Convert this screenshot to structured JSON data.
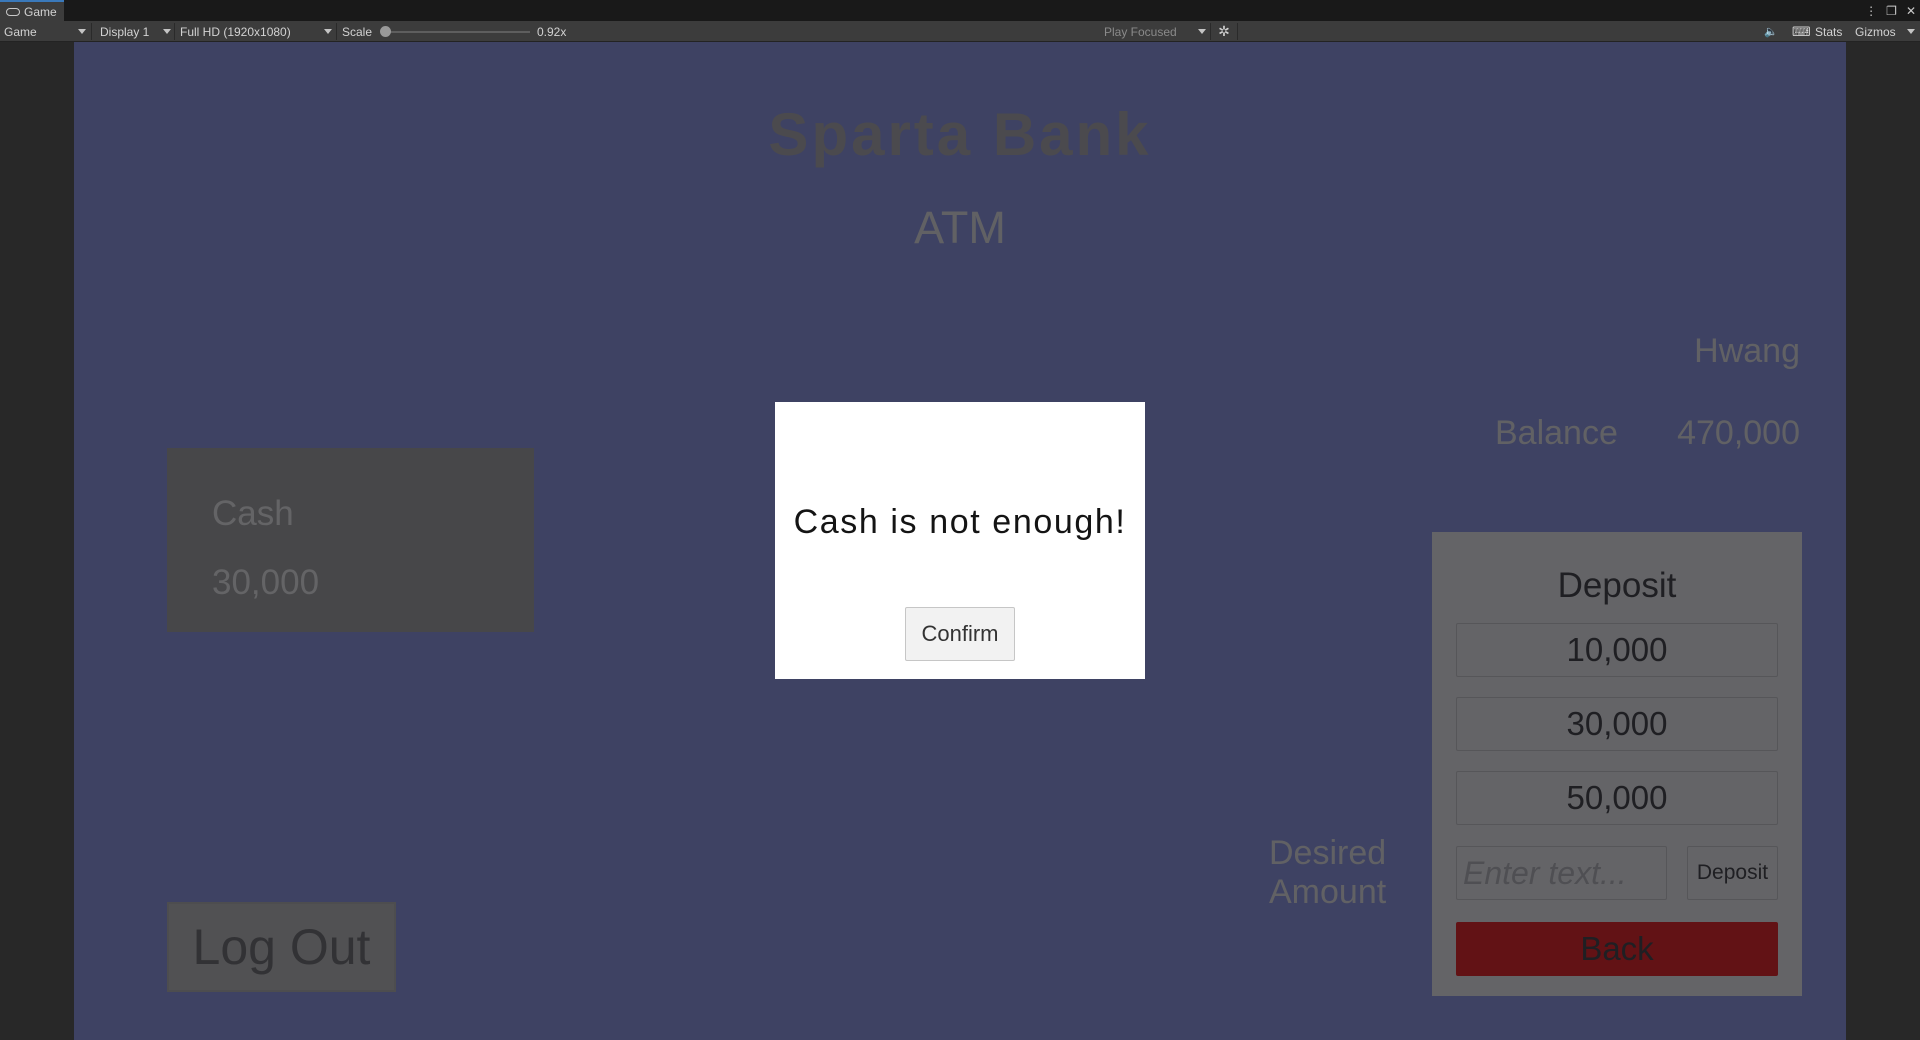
{
  "editor": {
    "tab_label": "Game",
    "toolbar": {
      "view_mode": "Game",
      "display": "Display 1",
      "resolution": "Full HD (1920x1080)",
      "scale_label": "Scale",
      "scale_value": "0.92x",
      "scale_fraction": 0.0,
      "play_mode": "Play Focused",
      "stats_label": "Stats",
      "gizmos_label": "Gizmos"
    }
  },
  "game": {
    "title": "Sparta Bank",
    "subtitle": "ATM",
    "user_name": "Hwang",
    "balance_label": "Balance",
    "balance_value": "470,000",
    "cash_label": "Cash",
    "cash_value": "30,000",
    "logout_label": "Log Out",
    "desired_amount_label_line1": "Desired",
    "desired_amount_label_line2": "Amount",
    "deposit_panel": {
      "title": "Deposit",
      "amounts": [
        "10,000",
        "30,000",
        "50,000"
      ],
      "input_placeholder": "Enter text...",
      "deposit_button": "Deposit",
      "back_button": "Back"
    },
    "popup": {
      "message": "Cash is not enough!",
      "confirm_label": "Confirm"
    }
  }
}
